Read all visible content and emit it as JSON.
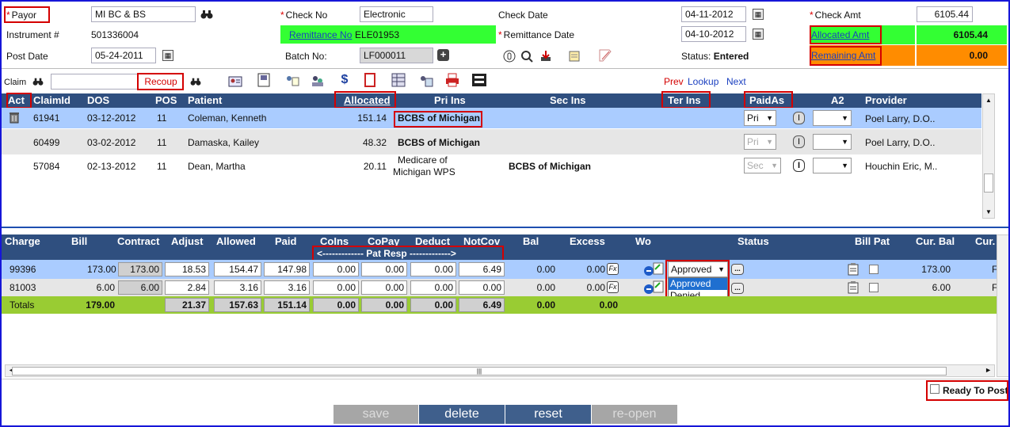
{
  "header": {
    "payor_label": "Payor",
    "payor_value": "MI BC & BS",
    "check_no_label": "Check No",
    "check_no_value": "Electronic",
    "check_date_label": "Check Date",
    "check_date_value": "04-11-2012",
    "check_amt_label": "Check Amt",
    "check_amt_value": "6105.44",
    "instrument_label": "Instrument #",
    "instrument_value": "501336004",
    "remittance_no_label": "Remittance No",
    "remittance_no_value": "ELE01953",
    "remittance_date_label": "Remittance Date",
    "remittance_date_value": "04-10-2012",
    "allocated_amt_label": "Allocated Amt",
    "allocated_amt_value": "6105.44",
    "post_date_label": "Post Date",
    "post_date_value": "05-24-2011",
    "batch_no_label": "Batch No:",
    "batch_no_value": "LF000011",
    "status_label": "Status:",
    "status_value": "Entered",
    "remaining_amt_label": "Remaining Amt",
    "remaining_amt_value": "0.00"
  },
  "claim_bar": {
    "claim_label": "Claim",
    "claim_value": "",
    "recoup_label": "Recoup",
    "prev": "Prev",
    "lookup": "Lookup",
    "next": "Next"
  },
  "claims": {
    "columns": [
      "Act",
      "ClaimId",
      "DOS",
      "POS",
      "Patient",
      "Allocated",
      "Pri Ins",
      "Sec Ins",
      "Ter Ins",
      "PaidAs",
      "A2",
      "Provider"
    ],
    "rows": [
      {
        "claim_id": "61941",
        "dos": "03-12-2012",
        "pos": "11",
        "patient": "Coleman, Kenneth",
        "allocated": "151.14",
        "pri_ins": "BCBS of Michigan",
        "sec_ins": "",
        "paid_as": "Pri",
        "provider": "Poel Larry, D.O.."
      },
      {
        "claim_id": "60499",
        "dos": "03-02-2012",
        "pos": "11",
        "patient": "Damaska, Kailey",
        "allocated": "48.32",
        "pri_ins": "BCBS of Michigan",
        "sec_ins": "",
        "paid_as": "Pri",
        "provider": "Poel Larry, D.O.."
      },
      {
        "claim_id": "57084",
        "dos": "02-13-2012",
        "pos": "11",
        "patient": "Dean, Martha",
        "allocated": "20.11",
        "pri_ins": "Medicare of Michigan WPS",
        "pri_ins_line1": "Medicare of",
        "pri_ins_line2": "Michigan WPS",
        "sec_ins": "BCBS of Michigan",
        "paid_as": "Sec",
        "provider": "Houchin Eric, M.."
      }
    ]
  },
  "charges": {
    "columns": [
      "Charge",
      "Bill",
      "Contract",
      "Adjust",
      "Allowed",
      "Paid",
      "CoIns",
      "CoPay",
      "Deduct",
      "NotCov",
      "Bal",
      "Excess",
      "Wo",
      "Status",
      "Bill Pat",
      "Cur. Bal",
      "Cur."
    ],
    "pat_resp_label": "<------------- Pat Resp ------------->",
    "rows": [
      {
        "charge": "99396",
        "bill": "173.00",
        "contract": "173.00",
        "adjust": "18.53",
        "allowed": "154.47",
        "paid": "147.98",
        "coins": "0.00",
        "copay": "0.00",
        "deduct": "0.00",
        "notcov": "6.49",
        "bal": "0.00",
        "excess": "0.00",
        "status": "Approved",
        "cur_bal": "173.00",
        "cur_tail": "F"
      },
      {
        "charge": "81003",
        "bill": "6.00",
        "contract": "6.00",
        "adjust": "2.84",
        "allowed": "3.16",
        "paid": "3.16",
        "coins": "0.00",
        "copay": "0.00",
        "deduct": "0.00",
        "notcov": "0.00",
        "bal": "0.00",
        "excess": "0.00",
        "status": "",
        "cur_bal": "6.00",
        "cur_tail": "F"
      }
    ],
    "totals": {
      "label": "Totals",
      "bill": "179.00",
      "adjust": "21.37",
      "allowed": "157.63",
      "paid": "151.14",
      "coins": "0.00",
      "copay": "0.00",
      "deduct": "0.00",
      "notcov": "6.49",
      "bal": "0.00",
      "excess": "0.00"
    },
    "status_options": [
      "Approved",
      "Denied"
    ],
    "fx_label": "Fx",
    "more_label": "..."
  },
  "footer": {
    "ready_to_post": "Ready To Post",
    "save": "save",
    "delete": "delete",
    "reset": "reset",
    "reopen": "re-open"
  },
  "colors": {
    "header_bar": "#2f4f7f",
    "allocated_green": "#33ff33",
    "remaining_orange": "#ff8c00",
    "selected_row": "#aaccff",
    "totals_green": "#99cc33",
    "annotation_red": "#d40000"
  }
}
